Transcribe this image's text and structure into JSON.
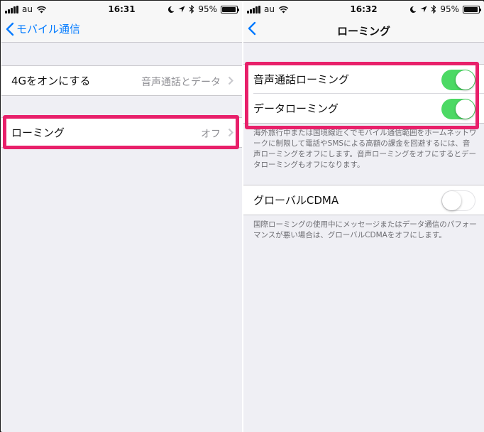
{
  "left_screen": {
    "status": {
      "carrier": "au",
      "time": "16:31",
      "battery": "95%"
    },
    "nav": {
      "back_label": "モバイル通信"
    },
    "rows": [
      {
        "label": "4Gをオンにする",
        "value": "音声通話とデータ"
      },
      {
        "label": "ローミング",
        "value": "オフ"
      }
    ]
  },
  "right_screen": {
    "status": {
      "carrier": "au",
      "time": "16:32",
      "battery": "95%"
    },
    "nav": {
      "title": "ローミング"
    },
    "toggles": [
      {
        "label": "音声通話ローミング",
        "state": "on"
      },
      {
        "label": "データローミング",
        "state": "on"
      }
    ],
    "roaming_note": "海外旅行中または国境線近くでモバイル通信範囲をホームネットワークに制限して電話やSMSによる高額の課金を回避するには、音声ローミングをオフにします。音声ローミングをオフにするとデータローミングもオフになります。",
    "cdma": {
      "label": "グローバルCDMA",
      "state": "off"
    },
    "cdma_note": "国際ローミングの使用中にメッセージまたはデータ通信のパフォーマンスが悪い場合は、グローバルCDMAをオフにします。"
  },
  "colors": {
    "accent": "#007aff",
    "switch_on": "#4cd964",
    "highlight": "#e8206a"
  },
  "icons": [
    "signal-icon",
    "wifi-icon",
    "moon-icon",
    "location-arrow-icon",
    "bluetooth-icon",
    "battery-icon",
    "back-chevron-icon",
    "disclosure-chevron-icon"
  ]
}
